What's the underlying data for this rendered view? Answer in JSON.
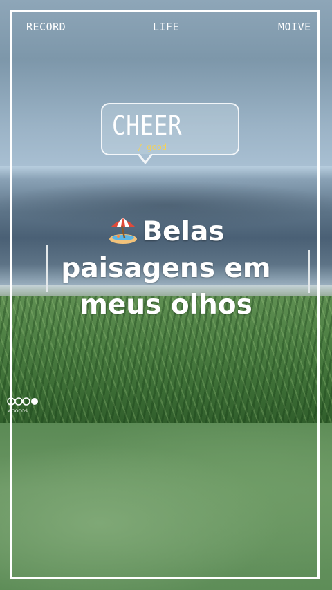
{
  "top_nav": {
    "left": "RECORD",
    "center": "LIFE",
    "right": "MOIVE"
  },
  "bubble": {
    "title": "CHEER",
    "slash": "/",
    "subtitle": "good"
  },
  "headline": {
    "line1": "Belas",
    "line2": "paisagens em",
    "line3": "meus olhos",
    "emoji_icon": "beach-umbrella-icon"
  },
  "watermark": {
    "text": "WOOOOS"
  },
  "colors": {
    "frame": "#ffffff",
    "accent_yellow": "#f2d25c"
  }
}
